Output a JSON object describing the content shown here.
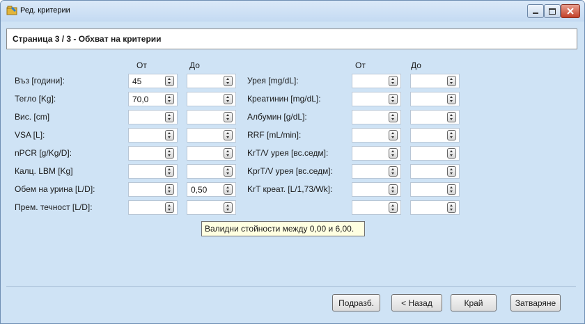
{
  "window": {
    "title": "Ред. критерии",
    "icon": "criteria-edit-icon",
    "controls": [
      "minimize-icon",
      "maximize-icon",
      "close-icon"
    ]
  },
  "page": {
    "header": "Страница 3 / 3 - Обхват на критерии"
  },
  "columns": {
    "from": "От",
    "to": "До"
  },
  "left_rows": [
    {
      "label": "Въз [години]:",
      "from": "45",
      "to": ""
    },
    {
      "label": "Тегло [Kg]:",
      "from": "70,0",
      "to": ""
    },
    {
      "label": "Вис. [cm]",
      "from": "",
      "to": ""
    },
    {
      "label": "VSA [L]:",
      "from": "",
      "to": ""
    },
    {
      "label": "nPCR [g/Kg/D]:",
      "from": "",
      "to": ""
    },
    {
      "label": "Калц. LBM [Kg]",
      "from": "",
      "to": ""
    },
    {
      "label": "Обем на урина [L/D]:",
      "from": "",
      "to": "0,50"
    },
    {
      "label": "Прем. течност [L/D]:",
      "from": "",
      "to": ""
    }
  ],
  "right_rows": [
    {
      "label": "Урея [mg/dL]:",
      "from": "",
      "to": ""
    },
    {
      "label": "Креатинин [mg/dL]:",
      "from": "",
      "to": ""
    },
    {
      "label": "Албумин [g/dL]:",
      "from": "",
      "to": ""
    },
    {
      "label": "RRF [mL/min]:",
      "from": "",
      "to": ""
    },
    {
      "label": "KrT/V урея [вс.седм]:",
      "from": "",
      "to": ""
    },
    {
      "label": "KprT/V урея [вс.седм]:",
      "from": "",
      "to": ""
    },
    {
      "label": "KrT креат. [L/1,73/Wk]:",
      "from": "",
      "to": ""
    },
    {
      "label": "",
      "from": "",
      "to": ""
    }
  ],
  "tooltip": "Валидни стойности между 0,00 и 6,00.",
  "buttons": {
    "defaults": "Подразб.",
    "back": "< Назад",
    "finish": "Край",
    "close": "Затваряне"
  }
}
